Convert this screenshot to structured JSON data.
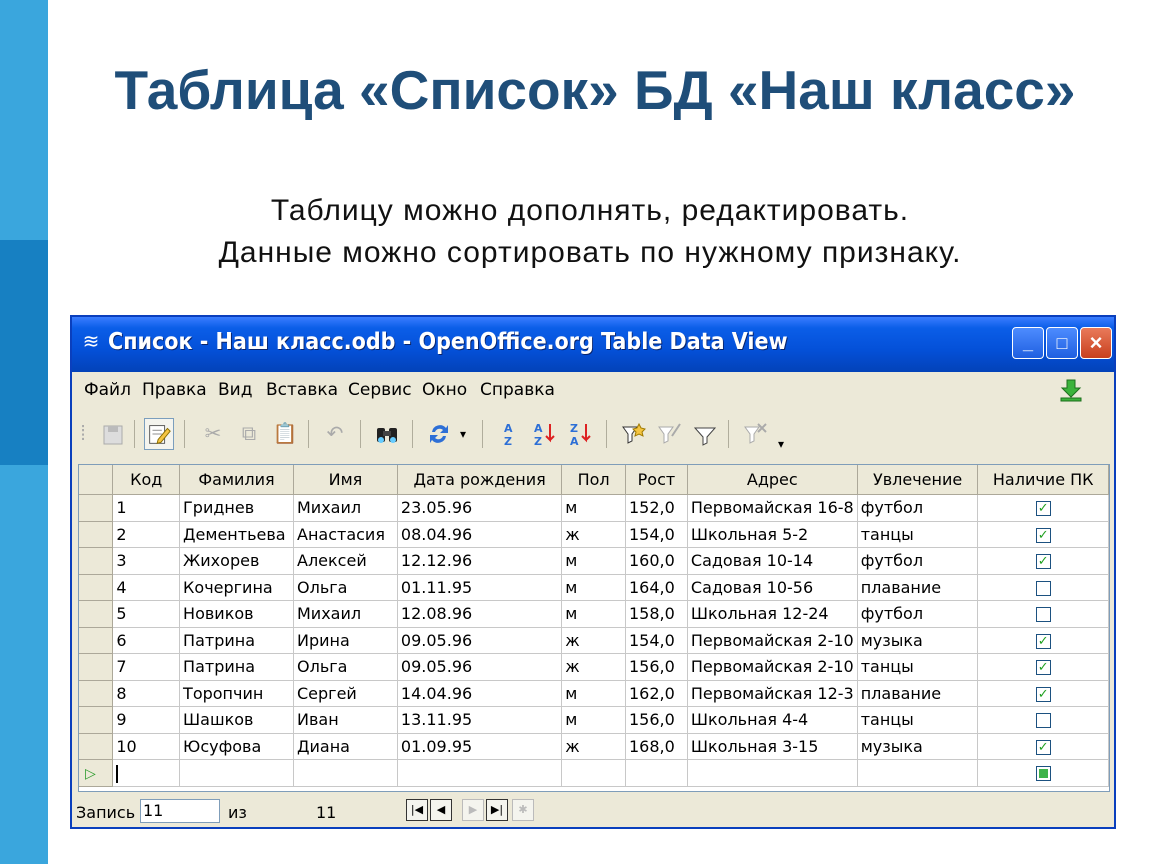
{
  "slide": {
    "title": "Таблица «Список»  БД «Наш класс»",
    "subtitle_line1": "Таблицу можно дополнять, редактировать.",
    "subtitle_line2": "Данные можно сортировать по нужному признаку."
  },
  "window": {
    "title": "Список - Наш класс.odb - OpenOffice.org Table Data View",
    "minimize": "_",
    "maximize": "□",
    "close": "×"
  },
  "menu": {
    "items": [
      "Файл",
      "Правка",
      "Вид",
      "Вставка",
      "Сервис",
      "Окно",
      "Справка"
    ]
  },
  "toolbar": {
    "icons": [
      "save-icon",
      "edit-icon",
      "cut-icon",
      "copy-icon",
      "paste-icon",
      "undo-icon",
      "find-icon",
      "refresh-icon",
      "sort-ascending-icon",
      "sort-descending-az-icon",
      "sort-descending-za-icon",
      "autofilter-icon",
      "standard-filter-icon",
      "filter-icon",
      "remove-filter-icon"
    ],
    "sort_asc": "A\nZ",
    "sort_1": "A↓Z",
    "sort_2": "Z↓A"
  },
  "table": {
    "columns": [
      "Код",
      "Фамилия",
      "Имя",
      "Дата рождения",
      "Пол",
      "Рост",
      "Адрес",
      "Увлечение",
      "Наличие ПК"
    ],
    "rows": [
      {
        "code": "1",
        "surname": "Гриднев",
        "name": "Михаил",
        "birth": "23.05.96",
        "sex": "м",
        "height": "152,0",
        "address": "Первомайская 16-8",
        "hobby": "футбол",
        "pc": true
      },
      {
        "code": "2",
        "surname": "Дементьева",
        "name": "Анастасия",
        "birth": "08.04.96",
        "sex": "ж",
        "height": "154,0",
        "address": "Школьная 5-2",
        "hobby": "танцы",
        "pc": true
      },
      {
        "code": "3",
        "surname": "Жихорев",
        "name": "Алексей",
        "birth": "12.12.96",
        "sex": "м",
        "height": "160,0",
        "address": "Садовая 10-14",
        "hobby": "футбол",
        "pc": true
      },
      {
        "code": "4",
        "surname": "Кочергина",
        "name": "Ольга",
        "birth": "01.11.95",
        "sex": "м",
        "height": "164,0",
        "address": "Садовая 10-56",
        "hobby": "плавание",
        "pc": false
      },
      {
        "code": "5",
        "surname": "Новиков",
        "name": "Михаил",
        "birth": "12.08.96",
        "sex": "м",
        "height": "158,0",
        "address": "Школьная 12-24",
        "hobby": "футбол",
        "pc": false
      },
      {
        "code": "6",
        "surname": "Патрина",
        "name": "Ирина",
        "birth": "09.05.96",
        "sex": "ж",
        "height": "154,0",
        "address": "Первомайская 2-10",
        "hobby": "музыка",
        "pc": true
      },
      {
        "code": "7",
        "surname": "Патрина",
        "name": "Ольга",
        "birth": "09.05.96",
        "sex": "ж",
        "height": "156,0",
        "address": "Первомайская 2-10",
        "hobby": "танцы",
        "pc": true
      },
      {
        "code": "8",
        "surname": "Торопчин",
        "name": "Сергей",
        "birth": "14.04.96",
        "sex": "м",
        "height": "162,0",
        "address": "Первомайская 12-3",
        "hobby": "плавание",
        "pc": true
      },
      {
        "code": "9",
        "surname": "Шашков",
        "name": "Иван",
        "birth": "13.11.95",
        "sex": "м",
        "height": "156,0",
        "address": "Школьная 4-4",
        "hobby": "танцы",
        "pc": false
      },
      {
        "code": "10",
        "surname": "Юсуфова",
        "name": "Диана",
        "birth": "01.09.95",
        "sex": "ж",
        "height": "168,0",
        "address": "Школьная 3-15",
        "hobby": "музыка",
        "pc": true
      }
    ],
    "new_row_marker": "▷"
  },
  "status": {
    "record_label": "Запись",
    "record_value": "11",
    "of_label": "из",
    "total": "11"
  },
  "colors": {
    "title": "#1f4e79",
    "stripe_light": "#3aa6dd",
    "stripe_dark": "#1780c2",
    "titlebar": "#0450d8"
  }
}
